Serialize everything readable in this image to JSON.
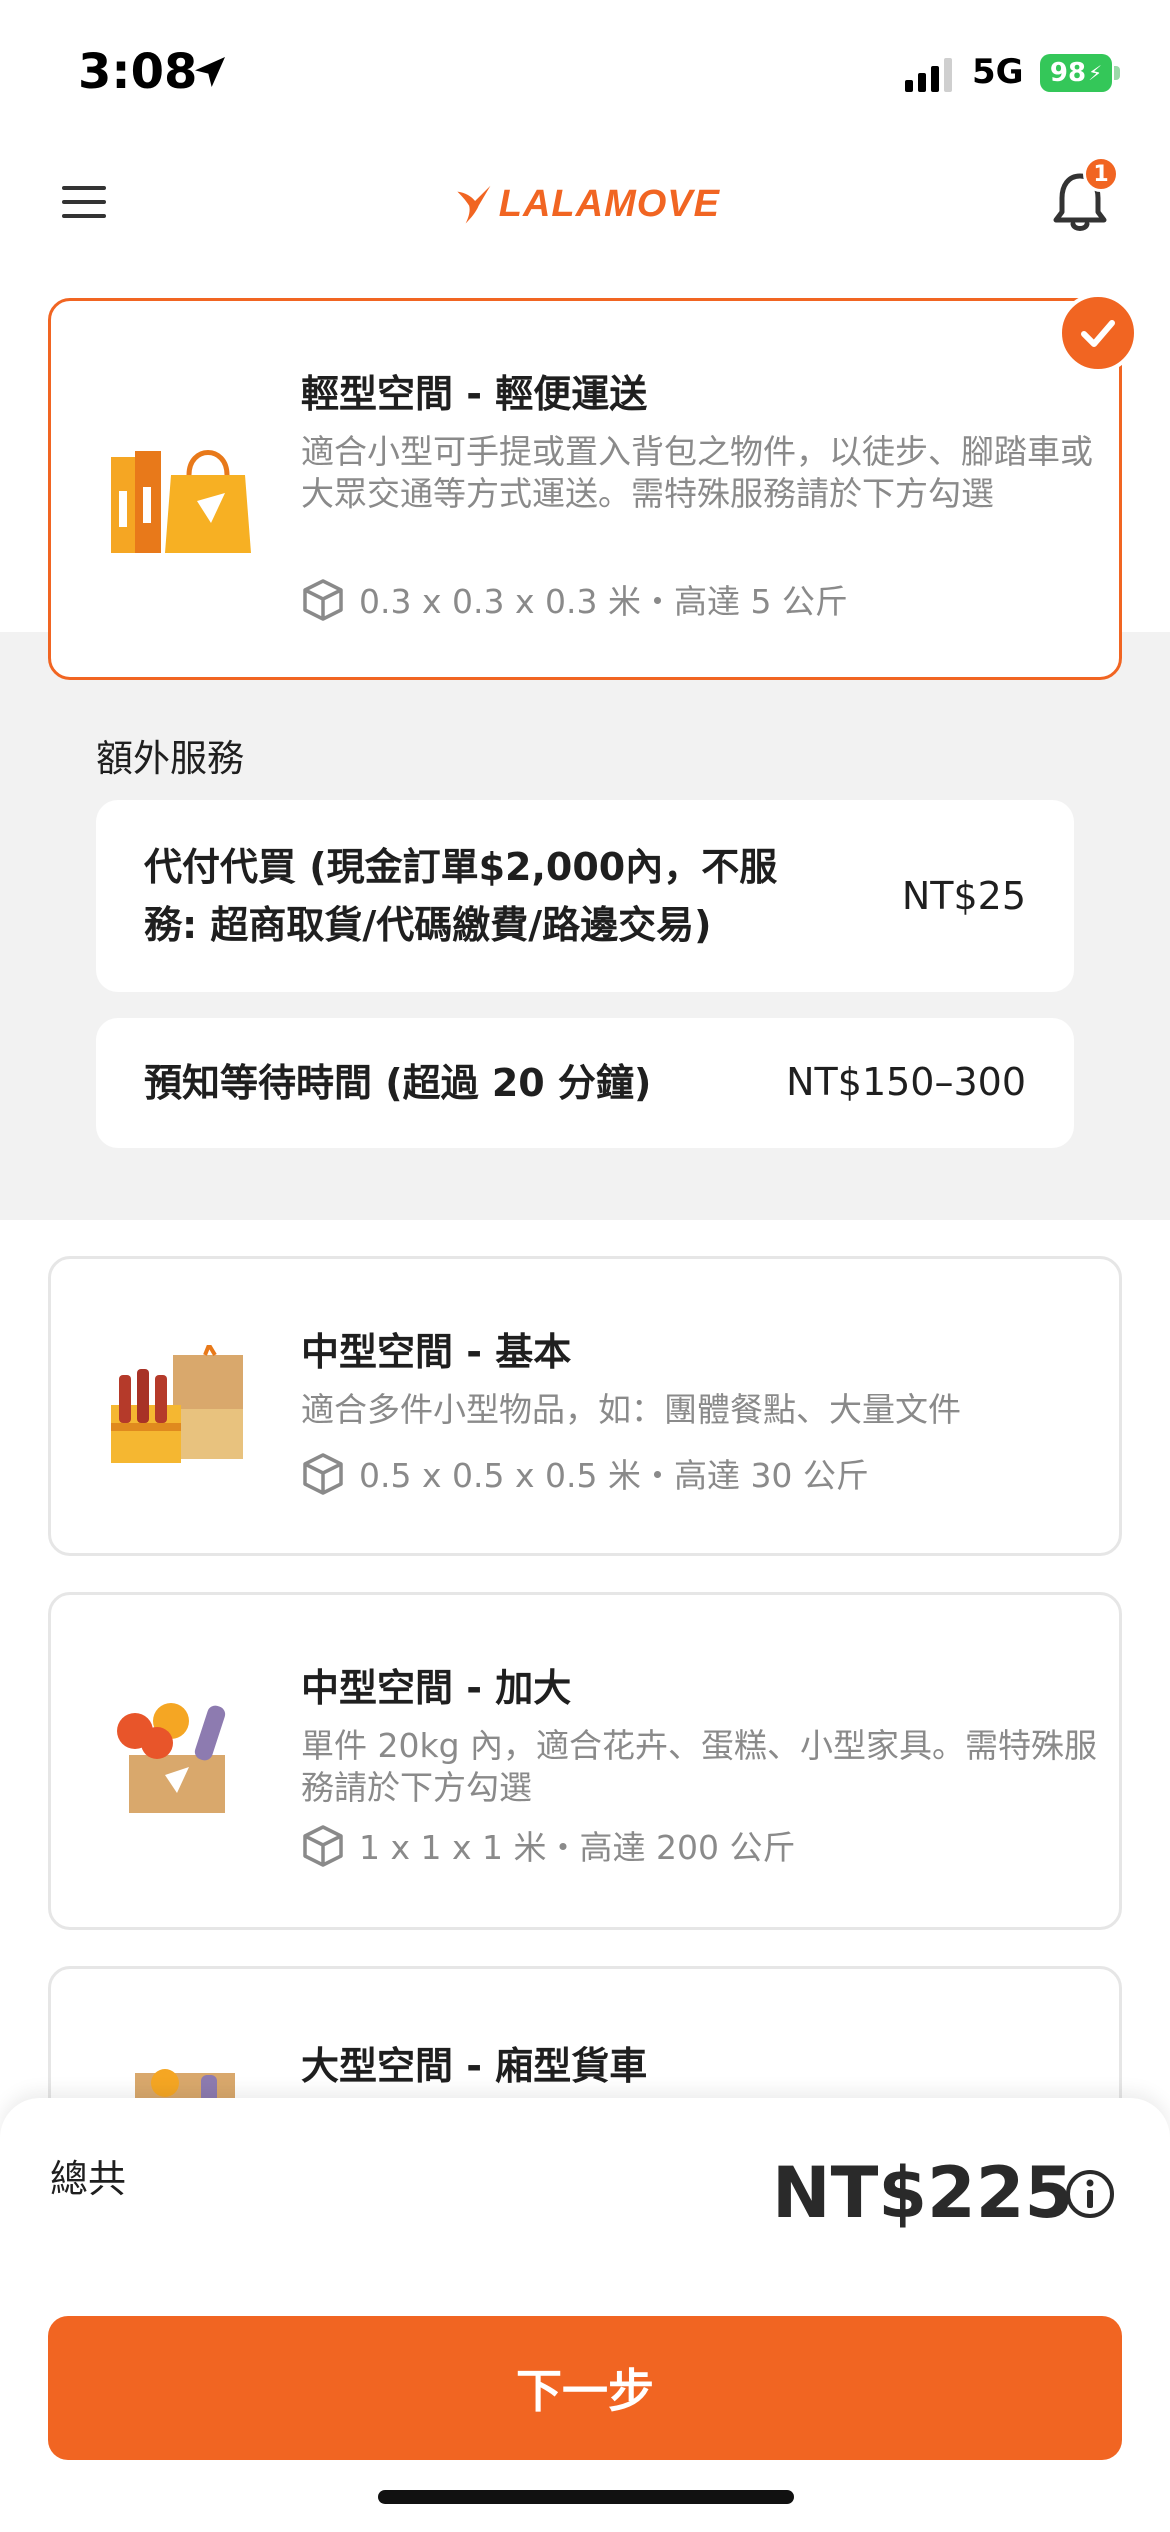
{
  "status_bar": {
    "time": "3:08",
    "network": "5G",
    "battery": "98"
  },
  "header": {
    "logo_text": "LALAMOVE",
    "notification_count": "1"
  },
  "vehicles": [
    {
      "title": "輕型空間 - 輕便運送",
      "description": "適合小型可手提或置入背包之物件，以徒步、腳踏車或大眾交通等方式運送。需特殊服務請於下方勾選",
      "spec": "0.3 x 0.3 x 0.3 米・高達 5 公斤",
      "selected": true
    },
    {
      "title": "中型空間 - 基本",
      "description": "適合多件小型物品，如：團體餐點、大量文件",
      "spec": "0.5 x 0.5 x 0.5 米・高達 30 公斤",
      "selected": false
    },
    {
      "title": "中型空間 - 加大",
      "description": "單件 20kg 內，適合花卉、蛋糕、小型家具。需特殊服務請於下方勾選",
      "spec": "1 x 1 x 1 米・高達 200 公斤",
      "selected": false
    },
    {
      "title": "大型空間 - 廂型貨車",
      "selected": false
    }
  ],
  "extras": {
    "title": "額外服務",
    "items": [
      {
        "label_line1": "代付代買 (現金訂單$2,000內，不服",
        "label_line2": "務: 超商取貨/代碼繳費/路邊交易)",
        "price": "NT$25"
      },
      {
        "label_line1": "預知等待時間 (超過 20 分鐘)",
        "price": "NT$150–300"
      }
    ]
  },
  "summary": {
    "total_label": "總共",
    "total_value": "NT$225"
  },
  "actions": {
    "next_label": "下一步"
  },
  "colors": {
    "brand": "#f16522",
    "battery": "#34c759"
  }
}
